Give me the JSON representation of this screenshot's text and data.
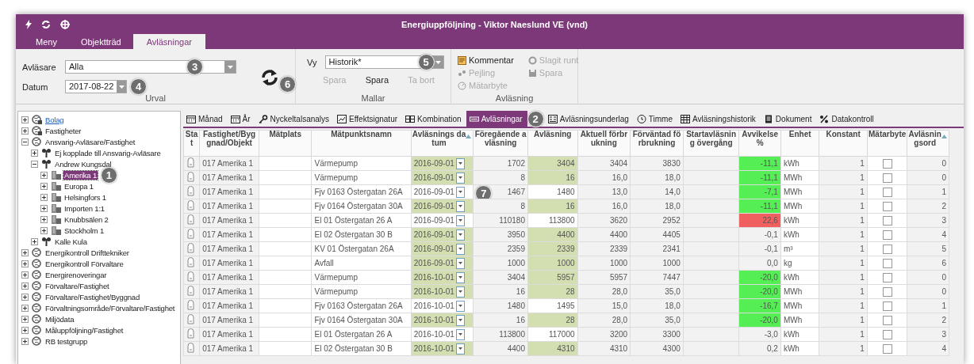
{
  "window": {
    "title": "Energiuppföljning - Viktor Naeslund VE (vnd)"
  },
  "tabs": [
    {
      "label": "Meny",
      "selected": false
    },
    {
      "label": "Objektträd",
      "selected": false
    },
    {
      "label": "Avläsningar",
      "selected": true
    }
  ],
  "ribbon": {
    "urval": {
      "label": "Urval",
      "reader_label": "Avläsare",
      "reader_value": "Alla",
      "reader_callout": "3",
      "date_label": "Datum",
      "date_value": "2017-08-22",
      "date_callout": "4",
      "refresh_callout": "6"
    },
    "mallar": {
      "label": "Mallar",
      "view_label": "Vy",
      "view_value": "Historik*",
      "view_callout": "5",
      "buttons": [
        {
          "label": "Spara",
          "disabled": true
        },
        {
          "label": "Spara",
          "disabled": false
        },
        {
          "label": "Ta bort",
          "disabled": true
        }
      ]
    },
    "avlasning": {
      "label": "Avläsning",
      "buttons": [
        {
          "label": "Kommentar",
          "kind": "comment",
          "disabled": false
        },
        {
          "label": "Slagit runt",
          "kind": "wrap",
          "disabled": true
        },
        {
          "label": "Pejling",
          "kind": "drops",
          "disabled": true
        },
        {
          "label": "Spara",
          "kind": "save",
          "disabled": true
        },
        {
          "label": "Mätarbyte",
          "kind": "meter",
          "disabled": true
        }
      ]
    }
  },
  "tree": [
    {
      "label": "Bolag",
      "kind": "locked",
      "expanded": false,
      "selected": false,
      "link": true
    },
    {
      "label": "Fastigheter",
      "kind": "locked",
      "expanded": false,
      "selected": false,
      "link": false
    },
    {
      "label": "Ansvarig-Avläsare/Fastighet",
      "kind": "globe",
      "expanded": true,
      "selected": false,
      "link": false,
      "children": [
        {
          "label": "Ej kopplade till Ansvarig-Avläsare",
          "kind": "person",
          "expanded": false,
          "selected": false,
          "link": false
        },
        {
          "label": "Andrew Kungsdal",
          "kind": "person",
          "expanded": true,
          "selected": false,
          "link": false,
          "children": [
            {
              "label": "Amerika 1",
              "kind": "building",
              "expanded": false,
              "selected": true,
              "link": false,
              "callout": "1"
            },
            {
              "label": "Europa 1",
              "kind": "building",
              "expanded": false,
              "selected": false,
              "link": false
            },
            {
              "label": "Helsingfors 1",
              "kind": "building",
              "expanded": false,
              "selected": false,
              "link": false
            },
            {
              "label": "Importen 1:1",
              "kind": "building",
              "expanded": false,
              "selected": false,
              "link": false
            },
            {
              "label": "Knubbsälen 2",
              "kind": "building",
              "expanded": false,
              "selected": false,
              "link": false
            },
            {
              "label": "Stockholm 1",
              "kind": "building",
              "expanded": false,
              "selected": false,
              "link": false
            }
          ]
        },
        {
          "label": "Kalle Kula",
          "kind": "person",
          "expanded": false,
          "selected": false,
          "link": false
        }
      ]
    },
    {
      "label": "Energikontroll Drifttekniker",
      "kind": "globe",
      "expanded": false,
      "selected": false,
      "link": false
    },
    {
      "label": "Energikontroll Förvaltare",
      "kind": "globe",
      "expanded": false,
      "selected": false,
      "link": false
    },
    {
      "label": "Energirenoveringar",
      "kind": "globe",
      "expanded": false,
      "selected": false,
      "link": false
    },
    {
      "label": "Förvaltare/Fastighet",
      "kind": "globe",
      "expanded": false,
      "selected": false,
      "link": false
    },
    {
      "label": "Förvaltare/Fastighet/Byggnad",
      "kind": "globe",
      "expanded": false,
      "selected": false,
      "link": false
    },
    {
      "label": "Förvaltningsområde/Förvaltare/Fastighet",
      "kind": "globe",
      "expanded": false,
      "selected": false,
      "link": false
    },
    {
      "label": "Miljödata",
      "kind": "globe",
      "expanded": false,
      "selected": false,
      "link": false
    },
    {
      "label": "Måluppföljning/Fastighet",
      "kind": "globe",
      "expanded": false,
      "selected": false,
      "link": false
    },
    {
      "label": "RB testgrupp",
      "kind": "globe",
      "expanded": false,
      "selected": false,
      "link": false
    }
  ],
  "view_tabs": [
    {
      "label": "Månad",
      "kind": "calendar",
      "selected": false
    },
    {
      "label": "År",
      "kind": "calendar",
      "selected": false
    },
    {
      "label": "Nyckeltalsanalys",
      "kind": "key",
      "selected": false
    },
    {
      "label": "Effektsignatur",
      "kind": "chart",
      "selected": false
    },
    {
      "label": "Kombination",
      "kind": "grid",
      "selected": false
    },
    {
      "label": "Avläsningar",
      "kind": "meter",
      "selected": true,
      "callout": "2"
    },
    {
      "label": "Avläsningsunderlag",
      "kind": "form",
      "selected": false
    },
    {
      "label": "Timme",
      "kind": "clock",
      "selected": false
    },
    {
      "label": "Avläsningshistorik",
      "kind": "table",
      "selected": false
    },
    {
      "label": "Dokument",
      "kind": "doc",
      "selected": false
    },
    {
      "label": "Datakontroll",
      "kind": "percent",
      "selected": false
    }
  ],
  "table": {
    "columns": [
      {
        "label": "Stat",
        "sorted": false
      },
      {
        "label": "Fastighet/Byggnad/Objekt",
        "sorted": false
      },
      {
        "label": "Mätplats",
        "sorted": false
      },
      {
        "label": "Mätpunktsnamn",
        "sorted": false
      },
      {
        "label": "Avläsnings datum",
        "sorted": true
      },
      {
        "label": "Föregående avläsning",
        "sorted": false
      },
      {
        "label": "Avläsning",
        "sorted": false
      },
      {
        "label": "Aktuell förbrukning",
        "sorted": false
      },
      {
        "label": "Förväntad förbrukning",
        "sorted": false
      },
      {
        "label": "Startavläsning övergång",
        "sorted": false
      },
      {
        "label": "Avvikelse %",
        "sorted": false
      },
      {
        "label": "Enhet",
        "sorted": false
      },
      {
        "label": "Konstant",
        "sorted": false
      },
      {
        "label": "Mätarbyte",
        "sorted": false
      },
      {
        "label": "Avläsningsord",
        "sorted": true
      }
    ],
    "rows": [
      {
        "object": "017 Amerika 1",
        "name": "Värmepump",
        "date": "2016-09-01",
        "previous": "1702",
        "reading": "3404",
        "highlighted": true,
        "actual": "3404",
        "expected": "3830",
        "deviation": "-11,1",
        "color": "#55ee55",
        "unit": "kWh",
        "constant": "1",
        "meter_change": false,
        "order": "0"
      },
      {
        "object": "017 Amerika 1",
        "name": "Värmepump",
        "date": "2016-09-01",
        "previous": "8",
        "reading": "16",
        "highlighted": true,
        "actual": "16,0",
        "expected": "18,0",
        "deviation": "-11,1",
        "color": "#55ee55",
        "unit": "MWh",
        "constant": "1",
        "meter_change": false,
        "order": "0"
      },
      {
        "object": "017 Amerika 1",
        "name": "Fjv 0163 Östergatan 26A",
        "date": "2016-09-01",
        "previous": "1467",
        "reading": "1480",
        "highlighted": false,
        "actual": "13,0",
        "expected": "14,0",
        "deviation": "-7,1",
        "color": "#55ee55",
        "unit": "MWh",
        "constant": "1",
        "meter_change": false,
        "order": "1",
        "callout": "7"
      },
      {
        "object": "017 Amerika 1",
        "name": "Fjv 0164 Östergatan 30A",
        "date": "2016-09-01",
        "previous": "8",
        "reading": "16",
        "highlighted": true,
        "actual": "16,0",
        "expected": "18,0",
        "deviation": "-11,1",
        "color": "#55ee55",
        "unit": "MWh",
        "constant": "1",
        "meter_change": false,
        "order": "2"
      },
      {
        "object": "017 Amerika 1",
        "name": "El 01 Östergatan 26 A",
        "date": "2016-09-01",
        "previous": "110180",
        "reading": "113800",
        "highlighted": false,
        "actual": "3620",
        "expected": "2952",
        "deviation": "22,6",
        "color": "#f06060",
        "unit": "kWh",
        "constant": "1",
        "meter_change": false,
        "order": "3"
      },
      {
        "object": "017 Amerika 1",
        "name": "El 02 Östergatan 30 B",
        "date": "2016-09-01",
        "previous": "3950",
        "reading": "4400",
        "highlighted": true,
        "actual": "4400",
        "expected": "4405",
        "deviation": "-0,1",
        "unit": "kWh",
        "constant": "1",
        "meter_change": false,
        "order": "4"
      },
      {
        "object": "017 Amerika 1",
        "name": "KV 01 Östergatan 26A",
        "date": "2016-09-01",
        "previous": "2359",
        "reading": "2339",
        "highlighted": true,
        "actual": "2339",
        "expected": "2341",
        "deviation": "-0,1",
        "unit": "m³",
        "constant": "1",
        "meter_change": false,
        "order": "5"
      },
      {
        "object": "017 Amerika 1",
        "name": "Avfall",
        "date": "2016-09-01",
        "previous": "1000",
        "reading": "1000",
        "highlighted": true,
        "actual": "1000",
        "expected": "1000",
        "deviation": "0,0",
        "unit": "kg",
        "constant": "1",
        "meter_change": false,
        "order": "6"
      },
      {
        "object": "017 Amerika 1",
        "name": "Värmepump",
        "date": "2016-10-01",
        "previous": "3404",
        "reading": "5957",
        "highlighted": true,
        "actual": "5957",
        "expected": "7447",
        "deviation": "-20,0",
        "color": "#55ee55",
        "unit": "kWh",
        "constant": "1",
        "meter_change": false,
        "order": "0"
      },
      {
        "object": "017 Amerika 1",
        "name": "Värmepump",
        "date": "2016-10-01",
        "previous": "16",
        "reading": "28",
        "highlighted": true,
        "actual": "28,0",
        "expected": "35,0",
        "deviation": "-20,0",
        "color": "#55ee55",
        "unit": "MWh",
        "constant": "1",
        "meter_change": false,
        "order": "0"
      },
      {
        "object": "017 Amerika 1",
        "name": "Fjv 0163 Östergatan 26A",
        "date": "2016-10-01",
        "previous": "1480",
        "reading": "1495",
        "highlighted": false,
        "actual": "15,0",
        "expected": "18,0",
        "deviation": "-16,7",
        "color": "#55ee55",
        "unit": "MWh",
        "constant": "1",
        "meter_change": false,
        "order": "1"
      },
      {
        "object": "017 Amerika 1",
        "name": "Fjv 0164 Östergatan 30A",
        "date": "2016-10-01",
        "previous": "16",
        "reading": "28",
        "highlighted": true,
        "actual": "28,0",
        "expected": "35,0",
        "deviation": "-20,0",
        "color": "#55ee55",
        "unit": "MWh",
        "constant": "1",
        "meter_change": false,
        "order": "2"
      },
      {
        "object": "017 Amerika 1",
        "name": "El 01 Östergatan 26 A",
        "date": "2016-10-01",
        "previous": "113800",
        "reading": "117000",
        "highlighted": false,
        "actual": "3200",
        "expected": "3300",
        "deviation": "-3,0",
        "unit": "kWh",
        "constant": "1",
        "meter_change": false,
        "order": "3"
      },
      {
        "object": "017 Amerika 1",
        "name": "El 02 Östergatan 30 B",
        "date": "2016-10-01",
        "previous": "4400",
        "reading": "4310",
        "highlighted": true,
        "actual": "4310",
        "expected": "4300",
        "deviation": "0,2",
        "unit": "kWh",
        "constant": "1",
        "meter_change": false,
        "order": "4"
      }
    ]
  }
}
